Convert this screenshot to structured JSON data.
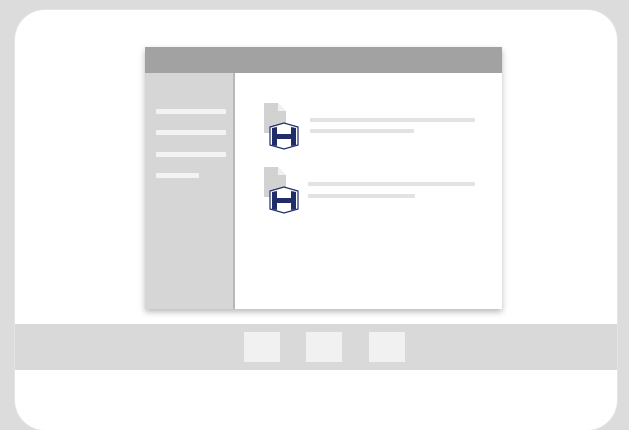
{
  "desktop": {
    "window": {
      "title": "",
      "sidebar": {
        "item_count": 4
      },
      "files": [
        {
          "name": "",
          "icon": "document-h-icon"
        },
        {
          "name": "",
          "icon": "document-h-icon"
        }
      ]
    },
    "taskbar": {
      "buttons": [
        "",
        "",
        ""
      ]
    }
  },
  "colors": {
    "background": "#dcdcdc",
    "title_bar": "#a2a2a2",
    "sidebar": "#d6d6d6",
    "file_badge": "#1f2d6b"
  }
}
